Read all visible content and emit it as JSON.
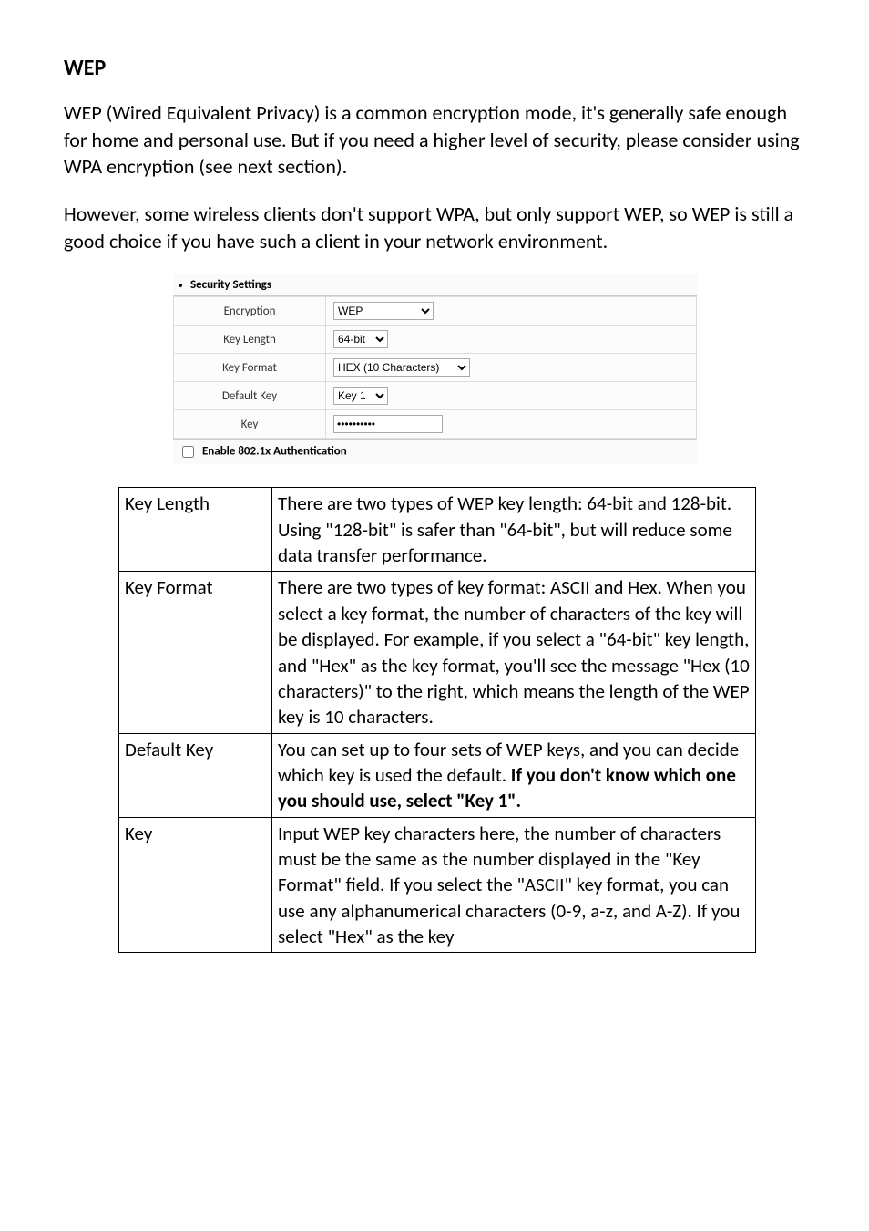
{
  "heading": "WEP",
  "paragraph1": "WEP (Wired Equivalent Privacy) is a common encryption mode, it's generally safe enough for home and personal use. But if you need a higher level of security, please consider using WPA encryption (see next section).",
  "paragraph2": "However, some wireless clients don't support WPA, but only support WEP, so WEP is still a good choice if you have such a client in your network environment.",
  "settings": {
    "section_title": "Security Settings",
    "rows": {
      "encryption_label": "Encryption",
      "encryption_value": "WEP",
      "keylength_label": "Key Length",
      "keylength_value": "64-bit",
      "keyformat_label": "Key Format",
      "keyformat_value": "HEX (10 Characters)",
      "defaultkey_label": "Default Key",
      "defaultkey_value": "Key 1",
      "key_label": "Key",
      "key_value": "**********"
    },
    "footer_checkbox_label": "Enable 802.1x Authentication"
  },
  "desc_table": {
    "r1_term": "Key Length",
    "r1_text": "There are two types of WEP key length: 64-bit and 128-bit. Using \"128-bit\" is safer than \"64-bit\", but will reduce some data transfer performance.",
    "r2_term": "Key Format",
    "r2_text": "There are two types of key format: ASCII and Hex. When you select a key format, the number of characters of the key will be displayed. For example, if you select a \"64-bit\" key length, and \"Hex\" as the key format, you'll see the message \"Hex (10 characters)\" to the right, which means the length of the WEP key is 10 characters.",
    "r3_term": "Default Key",
    "r3_text_a": "You can set up to four sets of WEP keys, and you can decide which key is used the default. ",
    "r3_text_b": "If you don't know which one you should use, select \"Key 1\".",
    "r4_term": "Key",
    "r4_text": "Input WEP key characters here, the number of characters must be the same as the number displayed in the \"Key Format\" field. If you select the \"ASCII\" key format, you can use any alphanumerical characters (0-9, a-z, and A-Z). If you select \"Hex\" as the key"
  }
}
